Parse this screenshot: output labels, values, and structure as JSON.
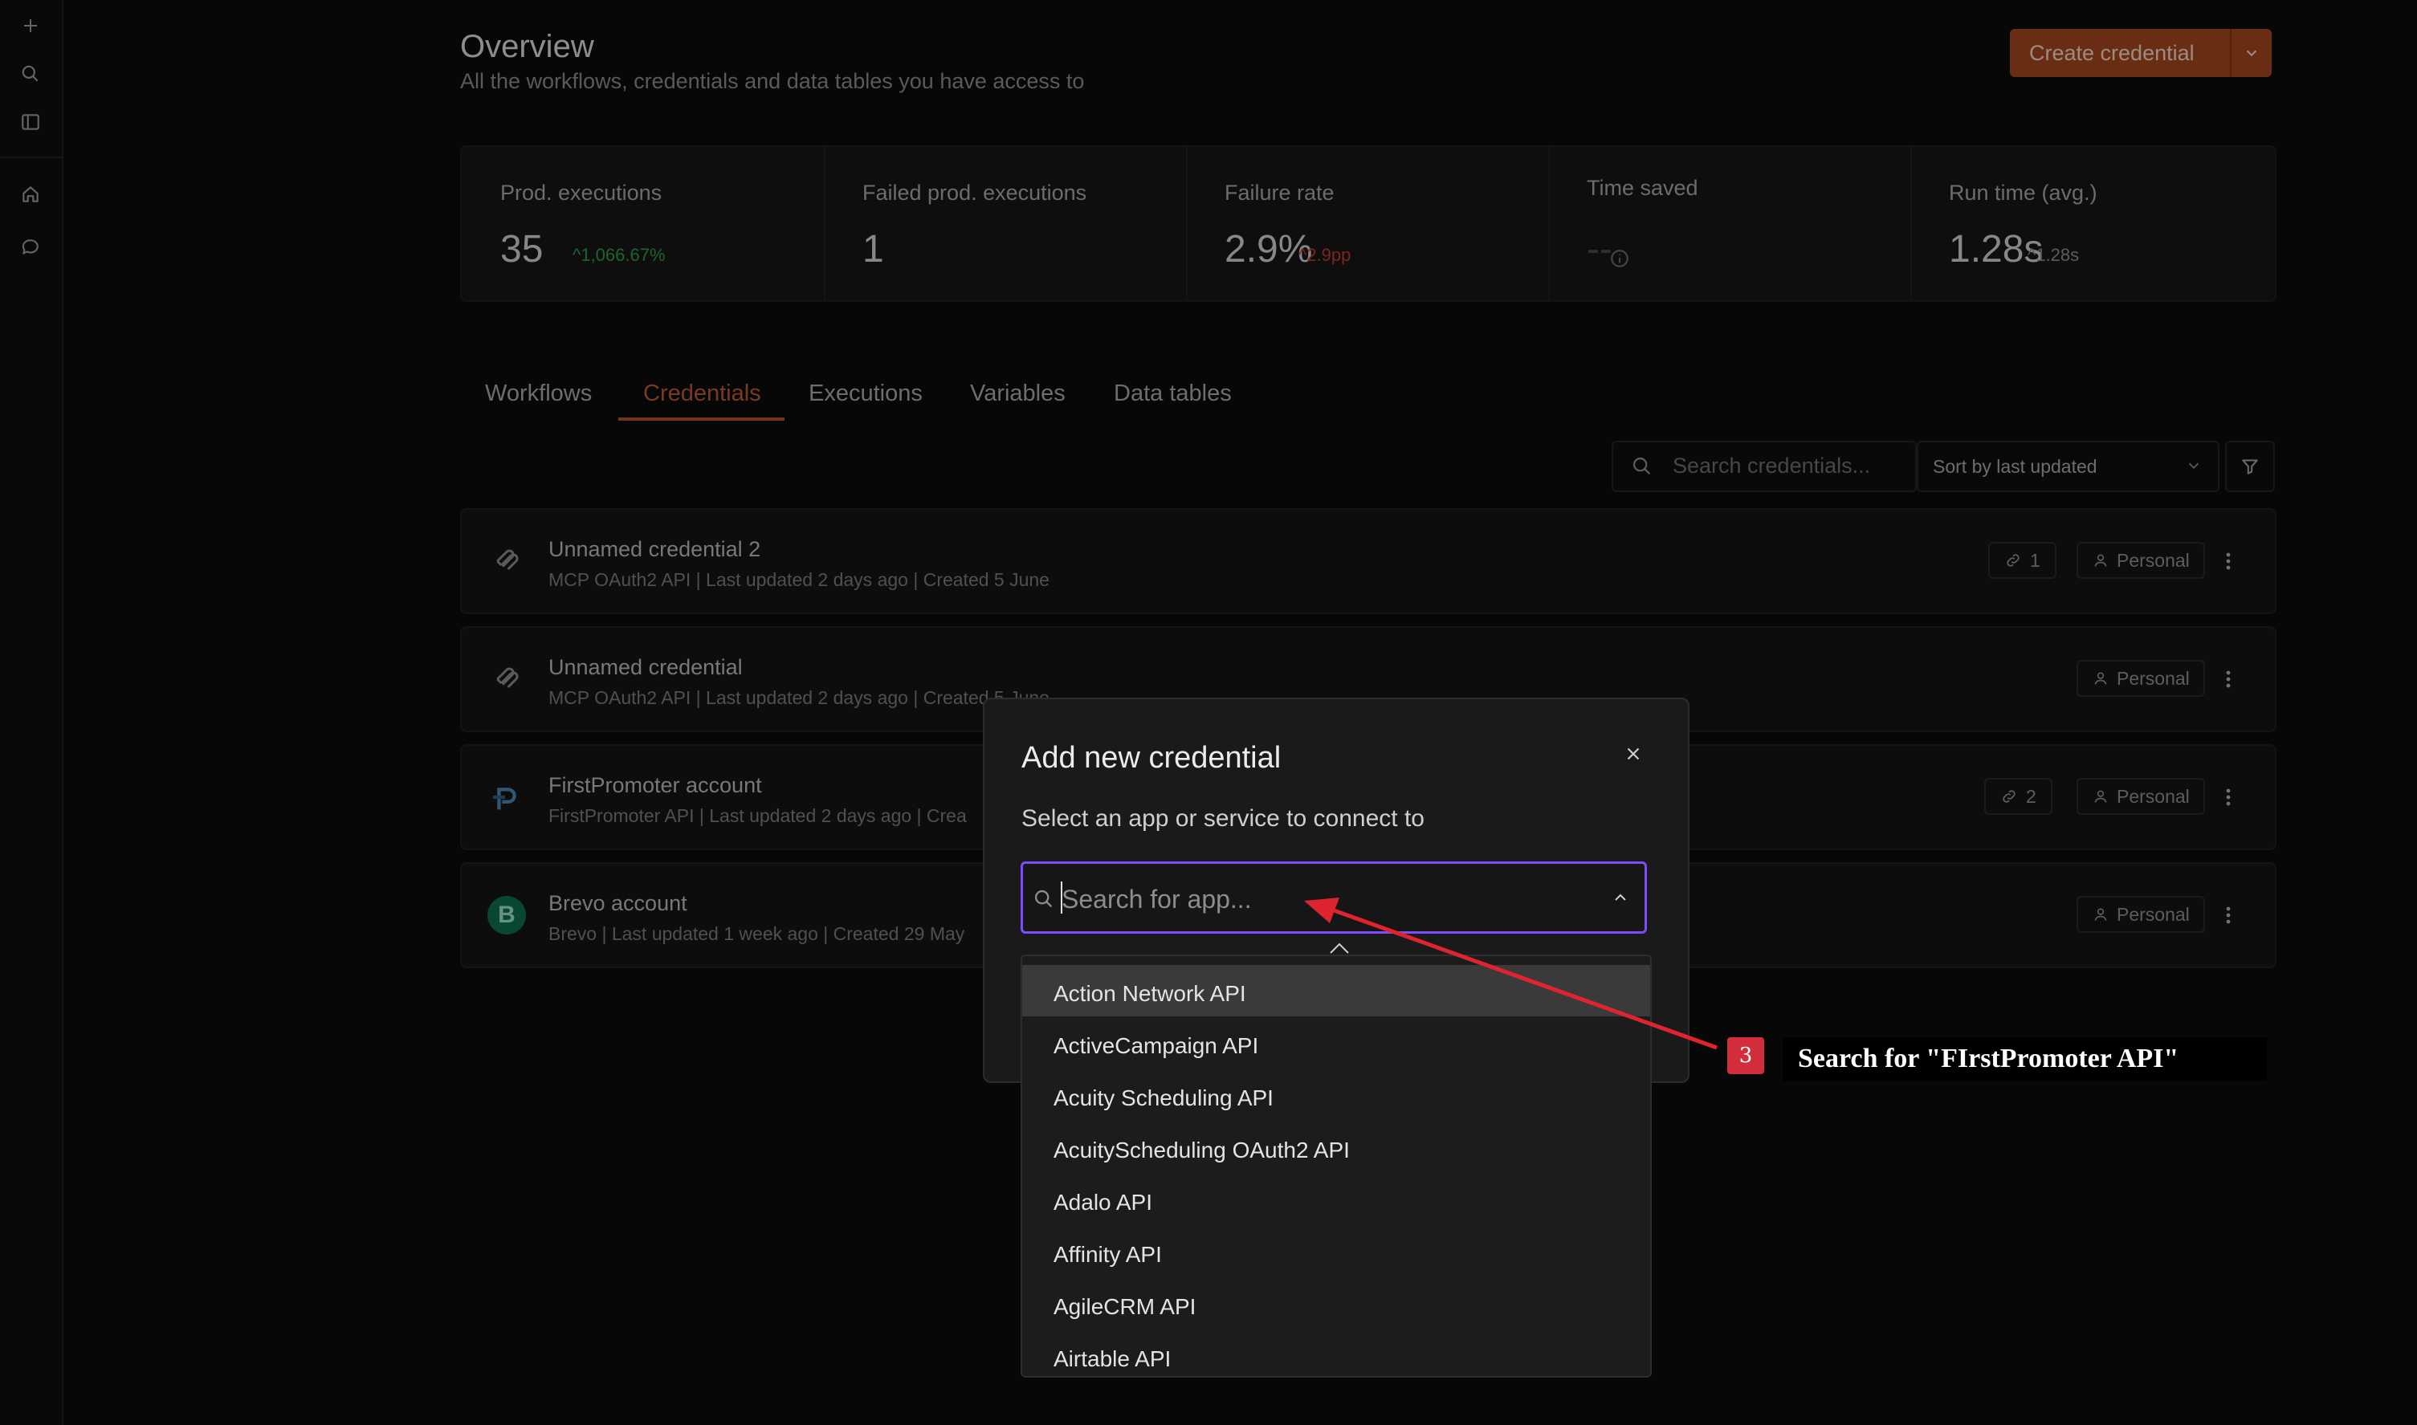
{
  "header": {
    "title": "Overview",
    "subtitle": "All the workflows, credentials and data tables you have access to",
    "create_label": "Create credential"
  },
  "stats": [
    {
      "label": "Prod. executions",
      "value": "35",
      "delta": "1,066.67%",
      "delta_color": "#2f9a4a"
    },
    {
      "label": "Failed prod. executions",
      "value": "1",
      "delta": "",
      "delta_color": ""
    },
    {
      "label": "Failure rate",
      "value": "2.9%",
      "delta": "2.9pp",
      "delta_color": "#c0392b"
    },
    {
      "label": "Time saved",
      "value": "--",
      "delta": "",
      "delta_color": ""
    },
    {
      "label": "Run time (avg.)",
      "value": "1.28s",
      "delta": "1.28s",
      "delta_color": "#8c8c8c"
    }
  ],
  "tabs": [
    "Workflows",
    "Credentials",
    "Executions",
    "Variables",
    "Data tables"
  ],
  "active_tab": "Credentials",
  "filters": {
    "search_placeholder": "Search credentials...",
    "sort_value": "Sort by last updated"
  },
  "credentials": [
    {
      "name": "Unnamed credential 2",
      "meta": "MCP OAuth2 API | Last updated 2 days ago | Created 5 June",
      "links": "1",
      "owner": "Personal",
      "icon": "mcp-icon"
    },
    {
      "name": "Unnamed credential",
      "meta": "MCP OAuth2 API | Last updated 2 days ago | Created 5 June",
      "links": "",
      "owner": "Personal",
      "icon": "mcp-icon"
    },
    {
      "name": "FirstPromoter account",
      "meta": "FirstPromoter API | Last updated 2 days ago | Crea",
      "links": "2",
      "owner": "Personal",
      "icon": "firstpromoter-icon"
    },
    {
      "name": "Brevo account",
      "meta": "Brevo | Last updated 1 week ago | Created 29 May",
      "links": "",
      "owner": "Personal",
      "icon": "brevo-icon",
      "icon_letter": "B"
    }
  ],
  "modal": {
    "title": "Add new credential",
    "subtitle": "Select an app or service to connect to",
    "search_placeholder": "Search for app..."
  },
  "app_options": [
    "Action Network API",
    "ActiveCampaign API",
    "Acuity Scheduling API",
    "AcuityScheduling OAuth2 API",
    "Adalo API",
    "Affinity API",
    "AgileCRM API",
    "Airtable API"
  ],
  "annotation": {
    "step": "3",
    "text": "Search for \"FIrstPromoter API\"",
    "color": "#d22d3a"
  }
}
